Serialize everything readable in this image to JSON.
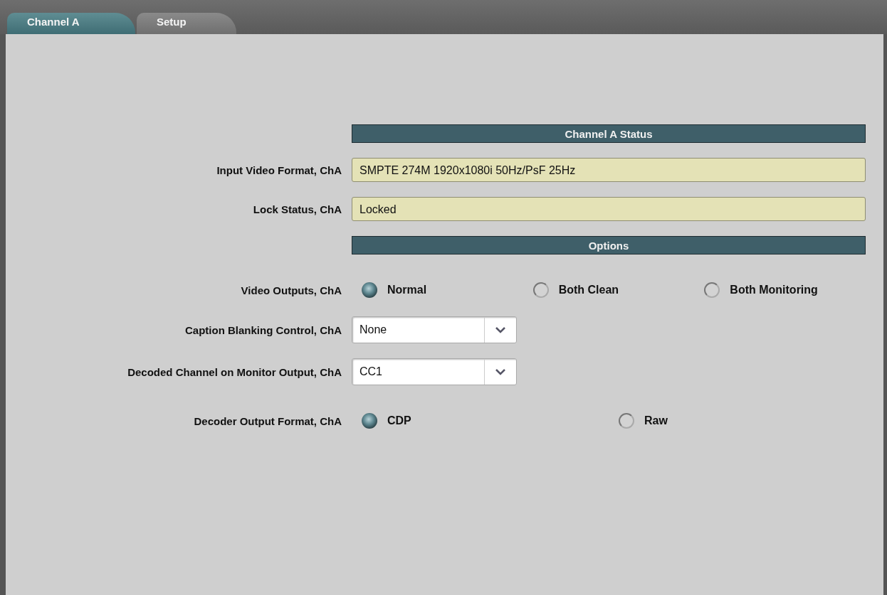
{
  "tabs": [
    {
      "label": "Channel A",
      "selected": true
    },
    {
      "label": "Setup",
      "selected": false
    }
  ],
  "rows": [
    {
      "kind": "header",
      "title": "Channel A Status"
    },
    {
      "kind": "text",
      "label": "Input Video Format, ChA",
      "value": "SMPTE 274M 1920x1080i 50Hz/PsF 25Hz"
    },
    {
      "kind": "text",
      "label": "Lock Status, ChA",
      "value": "Locked"
    },
    {
      "kind": "header",
      "title": "Options"
    },
    {
      "kind": "radio",
      "label": "Video Outputs, ChA",
      "options": [
        {
          "label": "Normal",
          "selected": true
        },
        {
          "label": "Both Clean",
          "selected": false
        },
        {
          "label": "Both Monitoring",
          "selected": false
        }
      ]
    },
    {
      "kind": "select",
      "label": "Caption Blanking Control, ChA",
      "value": "None"
    },
    {
      "kind": "select",
      "label": "Decoded Channel on Monitor Output, ChA",
      "value": "CC1"
    },
    {
      "kind": "radio",
      "label": "Decoder Output Format, ChA",
      "options": [
        {
          "label": "CDP",
          "selected": true
        },
        {
          "label": "Raw",
          "selected": false
        }
      ]
    }
  ]
}
